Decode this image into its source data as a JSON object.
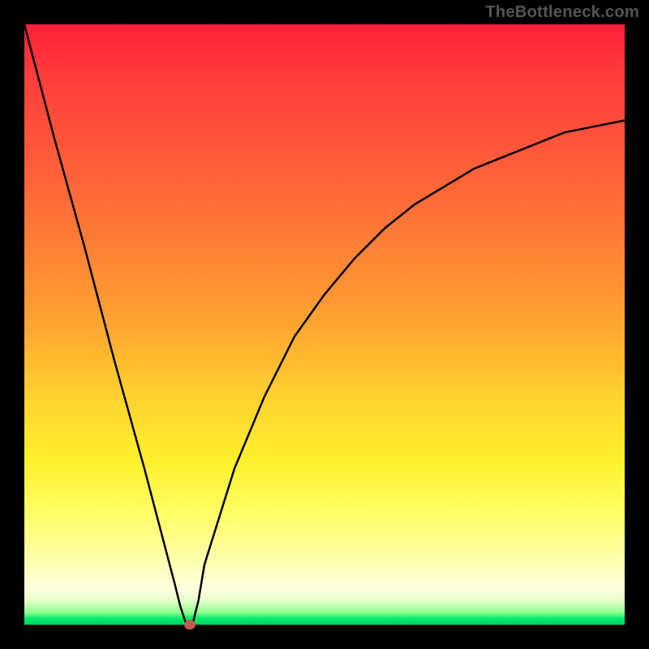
{
  "watermark": "TheBottleneck.com",
  "colors": {
    "frame_bg": "#000000",
    "curve_stroke": "#000000",
    "marker_fill": "#c75a50",
    "gradient_top": "#ff1f3a",
    "gradient_bottom": "#00d060"
  },
  "chart_data": {
    "type": "line",
    "title": "",
    "xlabel": "",
    "ylabel": "",
    "xlim": [
      0,
      100
    ],
    "ylim": [
      0,
      100
    ],
    "grid": false,
    "legend": false,
    "series": [
      {
        "name": "bottleneck-curve",
        "x": [
          0,
          5,
          10,
          15,
          20,
          25,
          26,
          27,
          28,
          29,
          30,
          35,
          40,
          45,
          50,
          55,
          60,
          65,
          70,
          75,
          80,
          85,
          90,
          95,
          100
        ],
        "y": [
          100,
          81,
          63,
          44,
          26,
          7,
          3,
          0,
          0,
          4,
          10,
          26,
          38,
          48,
          55,
          61,
          66,
          70,
          73,
          76,
          78,
          80,
          82,
          83,
          84
        ]
      }
    ],
    "annotations": [
      {
        "name": "minimum-marker",
        "x": 27.5,
        "y": 0
      }
    ],
    "background": {
      "type": "vertical-gradient",
      "stops": [
        {
          "pos": 0,
          "color": "#ff1f3a"
        },
        {
          "pos": 50,
          "color": "#ffa531"
        },
        {
          "pos": 73,
          "color": "#fff12e"
        },
        {
          "pos": 94,
          "color": "#ffffe0"
        },
        {
          "pos": 100,
          "color": "#00d060"
        }
      ]
    }
  }
}
